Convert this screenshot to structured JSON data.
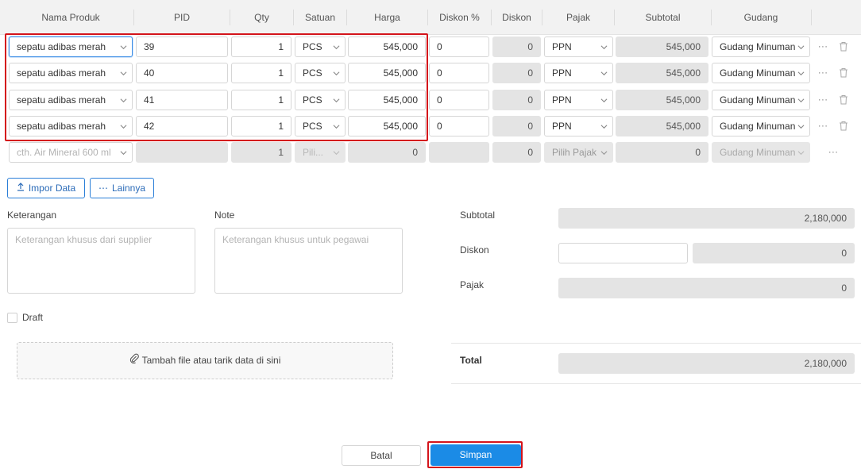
{
  "table": {
    "headers": [
      "Nama Produk",
      "PID",
      "Qty",
      "Satuan",
      "Harga",
      "Diskon %",
      "Diskon",
      "Pajak",
      "Subtotal",
      "Gudang"
    ],
    "rows": [
      {
        "produk": "sepatu adibas merah",
        "pid": "39",
        "qty": "1",
        "satuan": "PCS",
        "harga": "545,000",
        "diskon_pct": "0",
        "diskon": "0",
        "pajak": "PPN",
        "subtotal": "545,000",
        "gudang": "Gudang Minuman"
      },
      {
        "produk": "sepatu adibas merah",
        "pid": "40",
        "qty": "1",
        "satuan": "PCS",
        "harga": "545,000",
        "diskon_pct": "0",
        "diskon": "0",
        "pajak": "PPN",
        "subtotal": "545,000",
        "gudang": "Gudang Minuman"
      },
      {
        "produk": "sepatu adibas merah",
        "pid": "41",
        "qty": "1",
        "satuan": "PCS",
        "harga": "545,000",
        "diskon_pct": "0",
        "diskon": "0",
        "pajak": "PPN",
        "subtotal": "545,000",
        "gudang": "Gudang Minuman"
      },
      {
        "produk": "sepatu adibas merah",
        "pid": "42",
        "qty": "1",
        "satuan": "PCS",
        "harga": "545,000",
        "diskon_pct": "0",
        "diskon": "0",
        "pajak": "PPN",
        "subtotal": "545,000",
        "gudang": "Gudang Minuman"
      }
    ],
    "new_row": {
      "produk_placeholder": "cth. Air Mineral 600 ml",
      "qty": "1",
      "satuan_placeholder": "Pili...",
      "harga": "0",
      "diskon": "0",
      "pajak_placeholder": "Pilih Pajak",
      "subtotal": "0",
      "gudang": "Gudang Minuman"
    }
  },
  "actions": {
    "import_label": "Impor Data",
    "more_label": "Lainnya"
  },
  "form": {
    "keterangan_label": "Keterangan",
    "keterangan_placeholder": "Keterangan khusus dari supplier",
    "note_label": "Note",
    "note_placeholder": "Keterangan khusus untuk pegawai",
    "draft_label": "Draft",
    "dropzone_label": "Tambah file atau tarik data di sini"
  },
  "summary": {
    "subtotal_label": "Subtotal",
    "subtotal_value": "2,180,000",
    "diskon_label": "Diskon",
    "diskon_value": "0",
    "pajak_label": "Pajak",
    "pajak_value": "0",
    "total_label": "Total",
    "total_value": "2,180,000"
  },
  "footer": {
    "cancel_label": "Batal",
    "save_label": "Simpan"
  },
  "colors": {
    "accent": "#1b8be6",
    "highlight": "#d4141b"
  }
}
